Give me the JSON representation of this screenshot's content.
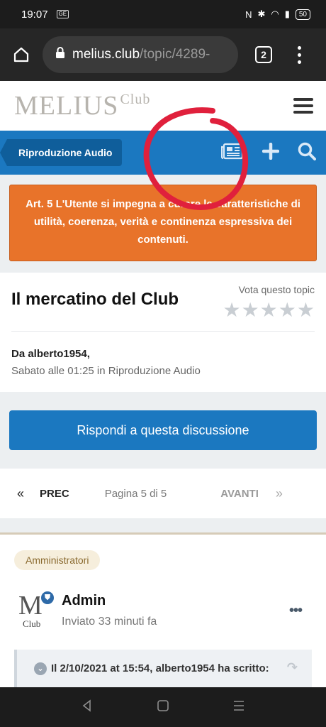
{
  "status_bar": {
    "time": "19:07",
    "carrier_badge": "GE",
    "battery": "50",
    "icons": [
      "nfc-icon",
      "bluetooth-icon",
      "wifi-icon",
      "signal-icon"
    ]
  },
  "browser": {
    "url_host": "melius.club",
    "url_path": "/topic/4289-",
    "tab_count": "2"
  },
  "site": {
    "logo_main": "MELIUS",
    "logo_sub": "Club"
  },
  "nav": {
    "breadcrumb": "Riproduzione Audio"
  },
  "rules_banner": {
    "text": "Art. 5 L'Utente si impegna a curare le caratteristiche di utilità, coerenza, verità e continenza espressiva dei contenuti."
  },
  "topic": {
    "title": "Il mercatino del Club",
    "vote_label": "Vota questo topic",
    "rating": 0,
    "max_rating": 5,
    "author_line": "Da alberto1954,",
    "meta_line": "Sabato alle 01:25 in Riproduzione Audio"
  },
  "reply_button": "Rispondi a questa discussione",
  "pagination": {
    "prev": "PREC",
    "page_info": "Pagina 5 di 5",
    "next": "AVANTI"
  },
  "post": {
    "role": "Amministratori",
    "avatar_letter": "M",
    "avatar_sub": "Club",
    "author": "Admin",
    "time": "Inviato 33 minuti fa",
    "more": "•••",
    "quote_header": "Il 2/10/2021 at 15:54, alberto1954 ha scritto:"
  },
  "colors": {
    "brand_blue": "#1b78c0",
    "rules_orange": "#e8732a",
    "annotation_red": "#e0203c"
  }
}
